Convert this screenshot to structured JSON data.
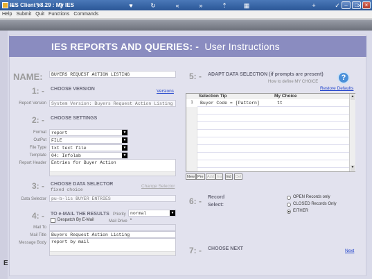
{
  "window": {
    "title": "IES Client v8.29 : My IES"
  },
  "menu": [
    "Help",
    "Submit",
    "Quit",
    "Functions",
    "Commands"
  ],
  "banner": {
    "title": "IES REPORTS AND QUERIES: -",
    "subtitle": "User Instructions"
  },
  "name": {
    "label": "NAME:",
    "value": "BUYERS REQUEST ACTION LISTING"
  },
  "choose_version": {
    "num": "1: -",
    "heading": "CHOOSE VERSION",
    "link": "Versions",
    "label": "Report Version",
    "value": "System Version: Buyers Request Action Listing"
  },
  "choose_settings": {
    "num": "2: -",
    "heading": "CHOOSE SETTINGS",
    "format": {
      "label": "Format",
      "value": "report"
    },
    "output": {
      "label": "OutPut",
      "value": "FILE"
    },
    "file_type": {
      "label": "File Type",
      "value": "txt text file"
    },
    "template": {
      "label": "Template",
      "value": "04: Infolab"
    },
    "header": {
      "label": "Report Header",
      "value": "Entries for Buyer Action"
    }
  },
  "data_selector": {
    "num": "3: -",
    "heading": "CHOOSE DATA SELECTOR",
    "link": "Change Selector",
    "choice": "fixed choice",
    "label": "Data Selector",
    "value": "pu-b-lis BUYER ENTRIES"
  },
  "email": {
    "num": "4: -",
    "heading": "TO e-MAIL THE RESULTS",
    "priority_label": "Priority",
    "priority_value": "normal",
    "despatch_label": "Despatch By E-Mail",
    "mail_drive_label": "Mail Drive",
    "mail_drive_value": "*",
    "mail_to_label": "Mail To",
    "mail_to_value": "",
    "mail_title_label": "Mail Title",
    "mail_title_value": "Buyers Request Action Listing",
    "mail_body_label": "Message Body",
    "mail_body_value": "report by mail"
  },
  "adapt": {
    "num": "5: -",
    "heading": "ADAPT DATA SELECTION (if prompts are present)",
    "help_text": "How to define MY CHOICE",
    "restore_link": "Restore Defaults",
    "columns": [
      "Selection Tip",
      "My Choice"
    ],
    "rows": [
      {
        "n": "1",
        "tip": "Buyer Code = [Pattern]",
        "choice": "tt"
      }
    ],
    "nav": [
      "New",
      "Pre",
      "Add",
      "Ins",
      "Ed",
      "Del"
    ]
  },
  "record": {
    "num": "6: -",
    "label1": "Record",
    "label2": "Select:",
    "options": [
      "OPEN Records only",
      "CLOSED Records Only",
      "EITHER"
    ],
    "selected": "EITHER"
  },
  "next": {
    "num": "7: -",
    "heading": "CHOOSE NEXT",
    "link": "Next"
  }
}
